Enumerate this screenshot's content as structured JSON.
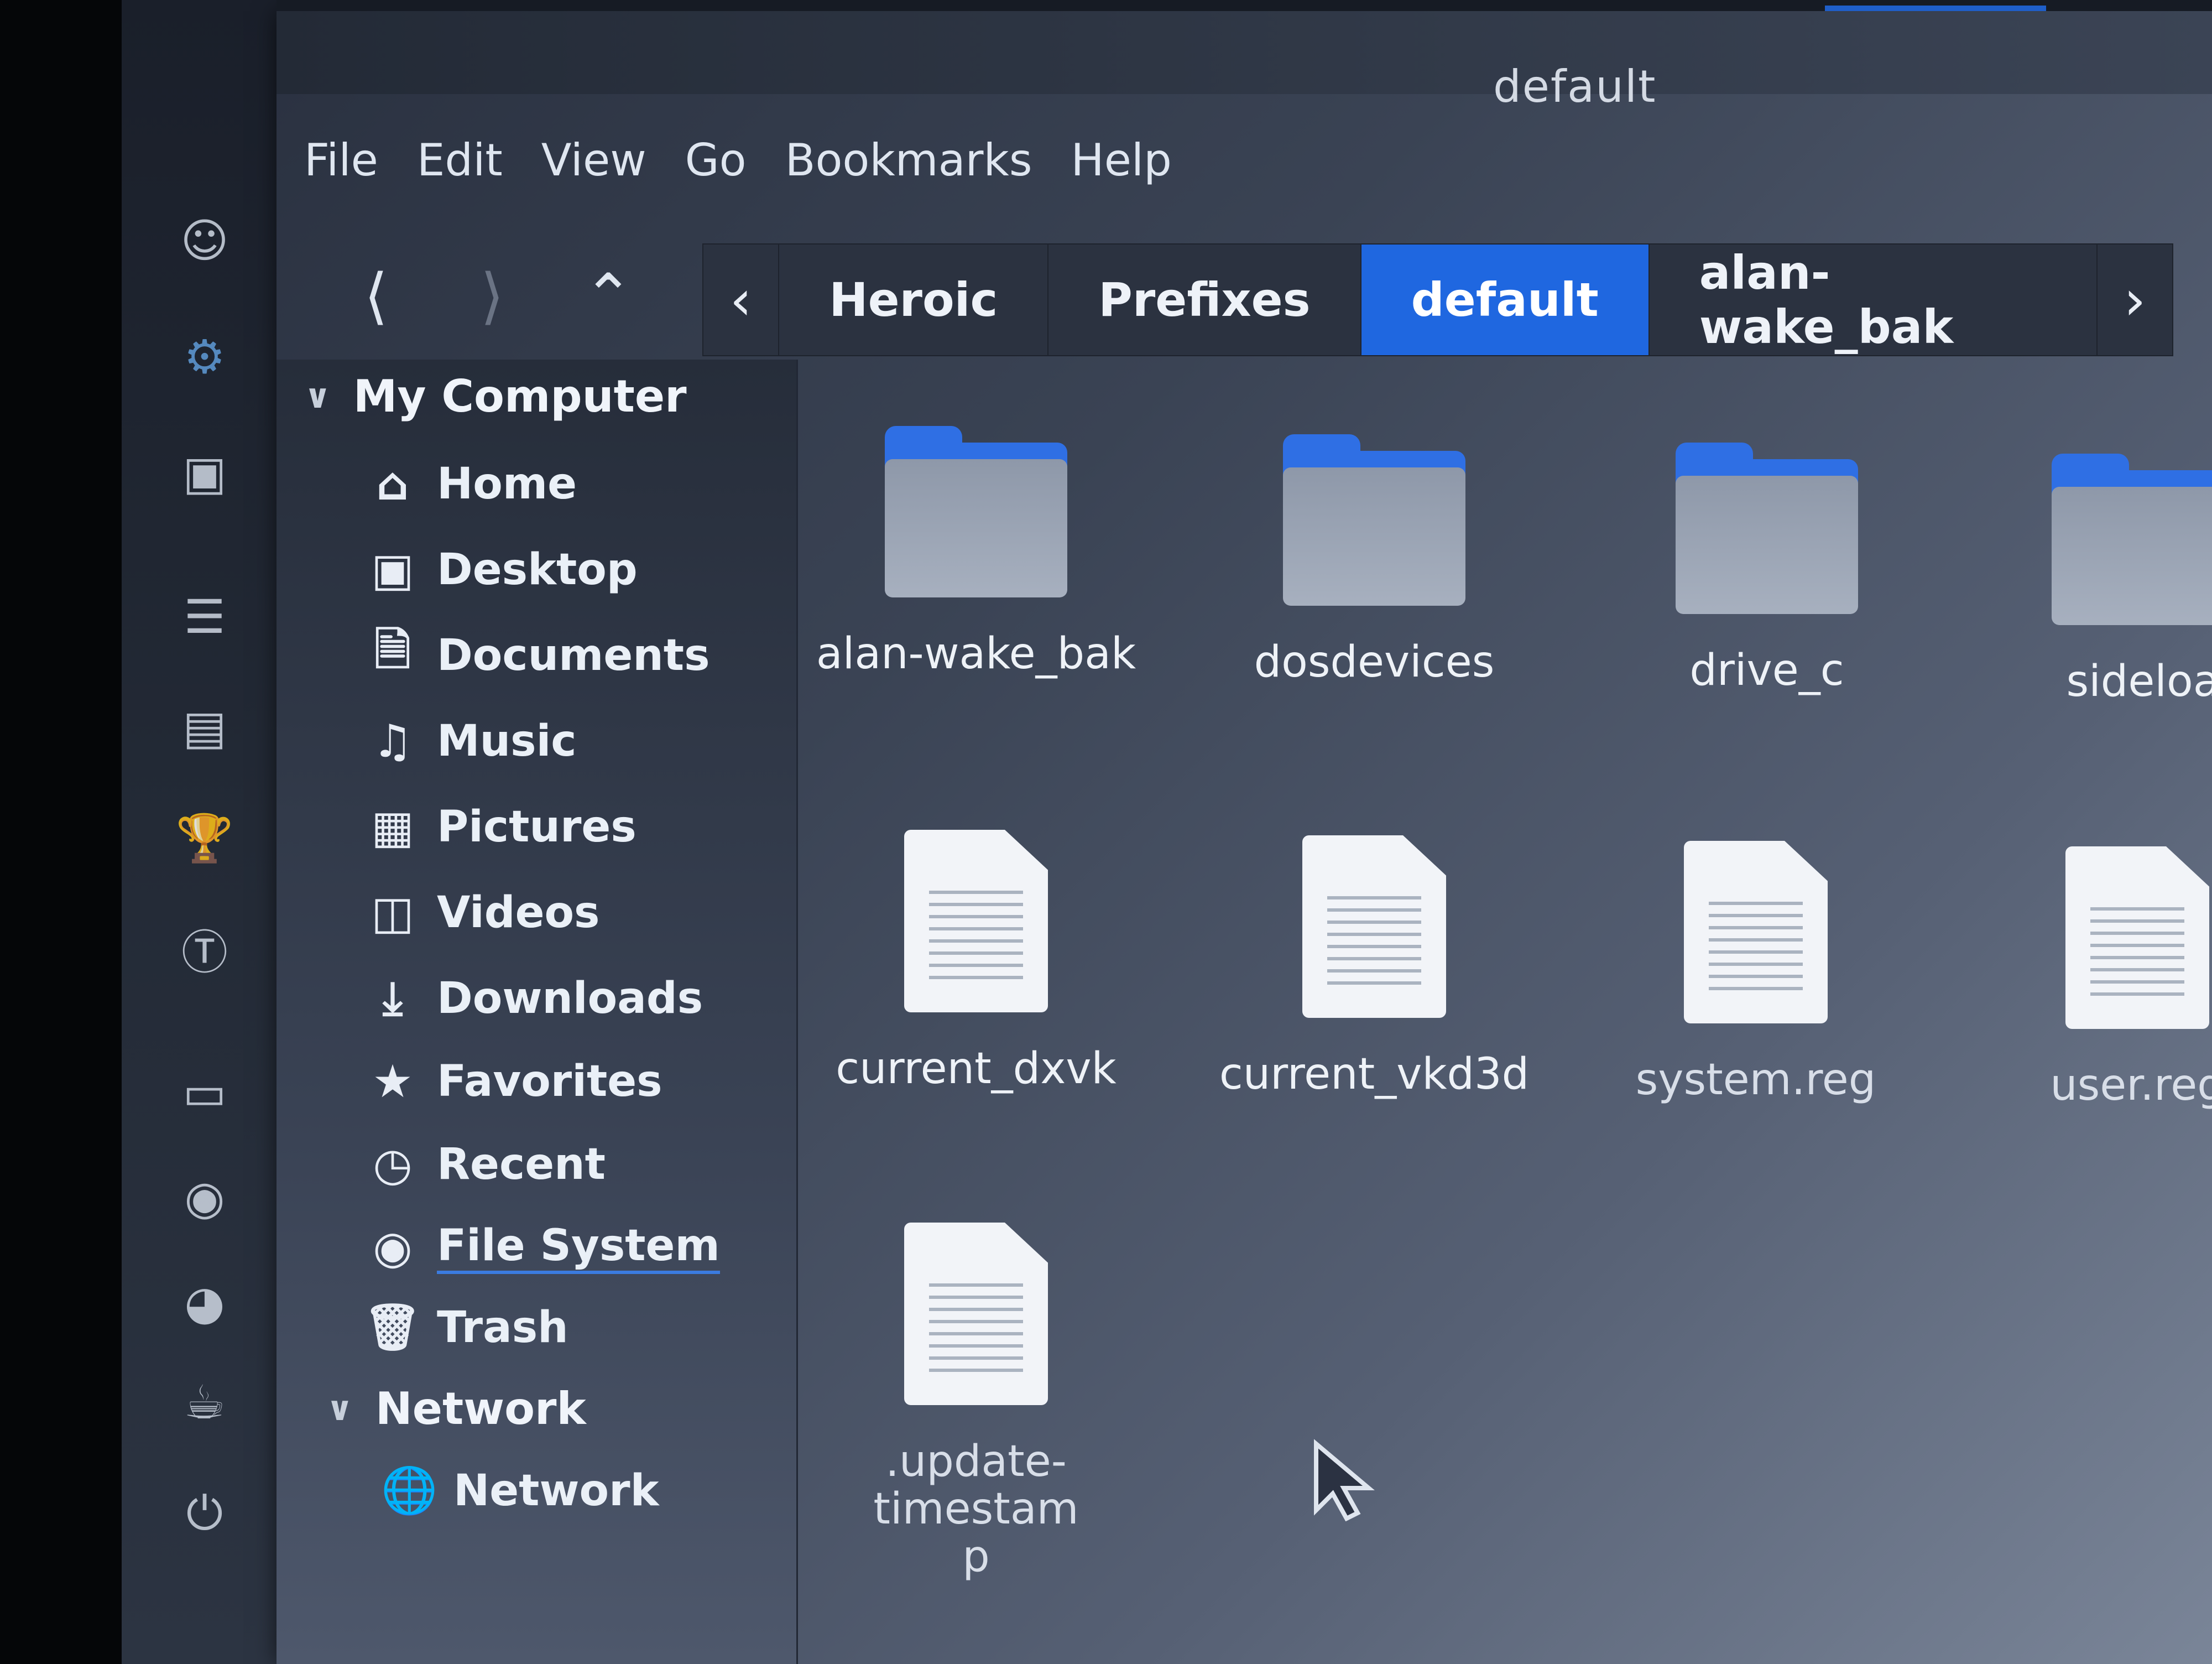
{
  "window": {
    "title": "default"
  },
  "menubar": [
    "File",
    "Edit",
    "View",
    "Go",
    "Bookmarks",
    "Help"
  ],
  "toolbar": {
    "back_icon": "chevron-left",
    "forward_icon": "chevron-right",
    "up_icon": "chevron-up",
    "breadcrumb": [
      "Heroic",
      "Prefixes",
      "default",
      "alan-wake_bak"
    ],
    "active_crumb": "default"
  },
  "sidebar": {
    "sections": [
      {
        "title": "My Computer",
        "items": [
          {
            "label": "Home",
            "icon": "home-icon"
          },
          {
            "label": "Desktop",
            "icon": "desktop-icon"
          },
          {
            "label": "Documents",
            "icon": "documents-icon"
          },
          {
            "label": "Music",
            "icon": "music-icon"
          },
          {
            "label": "Pictures",
            "icon": "pictures-icon"
          },
          {
            "label": "Videos",
            "icon": "videos-icon"
          },
          {
            "label": "Downloads",
            "icon": "downloads-icon"
          },
          {
            "label": "Favorites",
            "icon": "star-icon"
          },
          {
            "label": "Recent",
            "icon": "clock-icon"
          },
          {
            "label": "File System",
            "icon": "drive-icon"
          },
          {
            "label": "Trash",
            "icon": "trash-icon"
          }
        ]
      },
      {
        "title": "Network",
        "items": [
          {
            "label": "Network",
            "icon": "globe-icon"
          }
        ]
      }
    ]
  },
  "files": [
    {
      "name": "alan-wake_bak",
      "type": "folder"
    },
    {
      "name": "dosdevices",
      "type": "folder"
    },
    {
      "name": "drive_c",
      "type": "folder"
    },
    {
      "name": "sideloa",
      "type": "folder"
    },
    {
      "name": "current_dxvk",
      "type": "file"
    },
    {
      "name": "current_vkd3d",
      "type": "file"
    },
    {
      "name": "system.reg",
      "type": "file"
    },
    {
      "name": "user.reg",
      "type": "file"
    },
    {
      "name": ".update-timestamp",
      "type": "file"
    }
  ],
  "colors": {
    "accent": "#1f67e0",
    "folder_tab": "#2f6fe4"
  }
}
